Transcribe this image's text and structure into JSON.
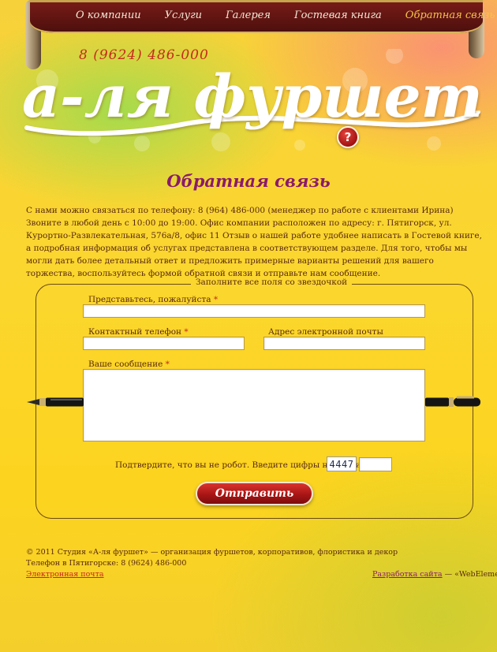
{
  "nav": {
    "items": [
      "О компании",
      "Услуги",
      "Галерея",
      "Гостевая книга",
      "Обратная связь"
    ],
    "active_index": 4
  },
  "header": {
    "phone": "8 (9624) 486-000",
    "logo_text": "а-ля фуршет",
    "help_symbol": "?"
  },
  "main": {
    "title": "Обратная связь",
    "intro": "С нами можно связаться по телефону: 8 (964) 486-000 (менеджер по работе с клиентами Ирина) Звоните в любой день с 10:00 до 19:00. Офис компании расположен по адресу: г. Пятигорск, ул. Курортно-Развлекательная, 576а/8, офис 11 Отзыв о нашей работе удобнее написать в Гостевой книге, а подробная информация об услугах представлена в соответствующем разделе. Для того, чтобы мы могли дать более детальный ответ и предложить примерные варианты решений для вашего торжества, воспользуйтесь формой обратной связи и отправьте нам сообщение."
  },
  "form": {
    "legend": "Заполните все поля со звездочкой",
    "name_label": "Представьтесь, пожалуйста",
    "phone_label": "Контактный телефон",
    "email_label": "Адрес электронной почты",
    "message_label": "Ваше сообщение",
    "required_mark": "*",
    "name_value": "",
    "phone_value": "",
    "email_value": "",
    "message_value": "",
    "captcha_label": "Подтвердите, что вы не робот. Введите цифры на картинке:",
    "captcha_code": "4447",
    "captcha_value": "",
    "submit_label": "Отправить"
  },
  "footer": {
    "copyright": "© 2011 Студия «А-ля фуршет» — организация фуршетов, корпоративов, флористика и декор",
    "phone_line": "Телефон в Пятигорске: 8 (9624) 486-000",
    "email_link": "Электронная почта",
    "dev_link": "Разработка сайта",
    "dev_suffix": " — «WebElement»"
  },
  "colors": {
    "ribbon": "#5a1210",
    "title": "#8a1a6e",
    "accent_red": "#c7291e",
    "text": "#5a2a10"
  }
}
